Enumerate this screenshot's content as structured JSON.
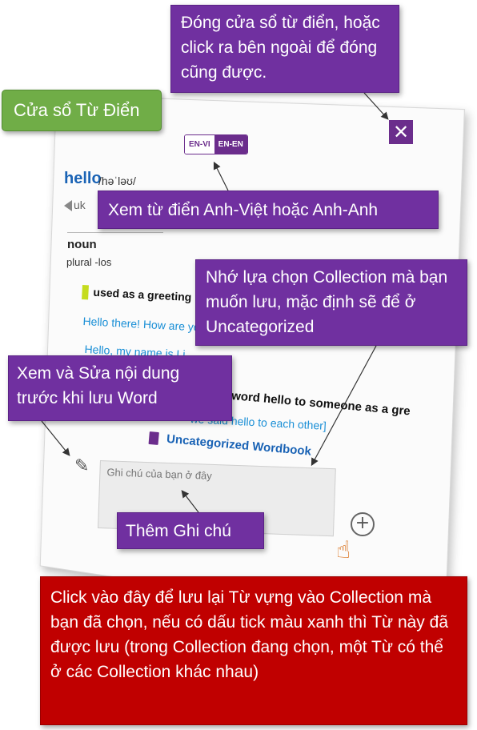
{
  "dictionary": {
    "close_symbol": "✕",
    "lang_toggle": {
      "en_vi": "EN-VI",
      "en_en": "EN-EN"
    },
    "word": "hello",
    "phonetic": "/həˈləʊ/",
    "accent_label": "uk",
    "part_of_speech": "noun",
    "plural": "plural -los",
    "sense": "used as a greeting",
    "examples": [
      "Hello there! How are you",
      "Hello, my name is Li",
      "we said hello to each other]"
    ],
    "definition_fragment": "word hello to someone as a gre",
    "collection_name": "Uncategorized Wordbook",
    "note_placeholder": "Ghi chú của bạn ở đây",
    "add_symbol": "+"
  },
  "callouts": {
    "window_title": "Cửa sổ Từ Điển",
    "close": "Đóng cửa sổ từ điển, hoặc click ra bên ngoài để đóng cũng được.",
    "lang": "Xem từ điển Anh-Việt hoặc Anh-Anh",
    "collection": "Nhớ lựa chọn Collection mà bạn muốn lưu, mặc định sẽ để ở Uncategorized",
    "edit": "Xem và Sửa nội dung trước khi lưu Word",
    "note": "Thêm Ghi chú",
    "save": "Click vào đây để lưu lại Từ vựng vào Collection mà bạn đã chọn, nếu có dấu tick màu xanh thì Từ này đã được lưu (trong Collection đang chọn, một Từ có thể ở các Collection khác nhau)"
  },
  "colors": {
    "purple": "#7030a0",
    "green": "#70ad47",
    "red": "#c00000",
    "link_blue": "#1a63b5"
  },
  "icons": [
    "speaker-icon",
    "book-icon",
    "edit-icon",
    "plus-circle-icon",
    "pointing-hand-icon",
    "close-icon"
  ]
}
